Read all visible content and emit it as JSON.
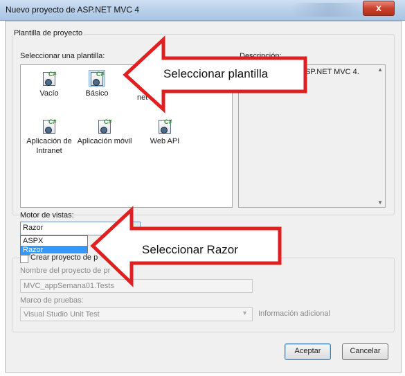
{
  "window": {
    "title": "Nuevo proyecto de ASP.NET MVC 4",
    "close_label": "x"
  },
  "template_group": {
    "title": "Plantilla de proyecto",
    "select_label": "Seleccionar una plantilla:",
    "desc_label": "Descripción:",
    "description": "SP.NET MVC 4.",
    "templates": [
      {
        "label": "Vacío",
        "icon": "mvc-project-icon"
      },
      {
        "label": "Básico",
        "icon": "mvc-project-icon"
      },
      {
        "label": "net",
        "icon": "mvc-project-icon"
      },
      {
        "label": "Aplicación de Intranet",
        "icon": "mvc-project-icon"
      },
      {
        "label": "Aplicación móvil",
        "icon": "mvc-project-icon"
      },
      {
        "label": "Web API",
        "icon": "mvc-project-icon"
      }
    ]
  },
  "view_engine": {
    "label": "Motor de vistas:",
    "selected": "Razor",
    "options": [
      "ASPX",
      "Razor"
    ]
  },
  "unit_test": {
    "checkbox_label": "Crear proyecto de p",
    "project_name_label": "Nombre del proyecto de pr",
    "project_name_value": "MVC_appSemana01.Tests",
    "framework_label": "Marco de pruebas:",
    "framework_value": "Visual Studio Unit Test",
    "more_info": "Información adicional"
  },
  "buttons": {
    "accept": "Aceptar",
    "cancel": "Cancelar"
  },
  "annotations": {
    "top": "Seleccionar plantilla",
    "bottom": "Seleccionar Razor"
  },
  "colors": {
    "selection": "#3399ff",
    "arrow_stroke": "#e02020",
    "title_bar": "#b9d0ea"
  }
}
